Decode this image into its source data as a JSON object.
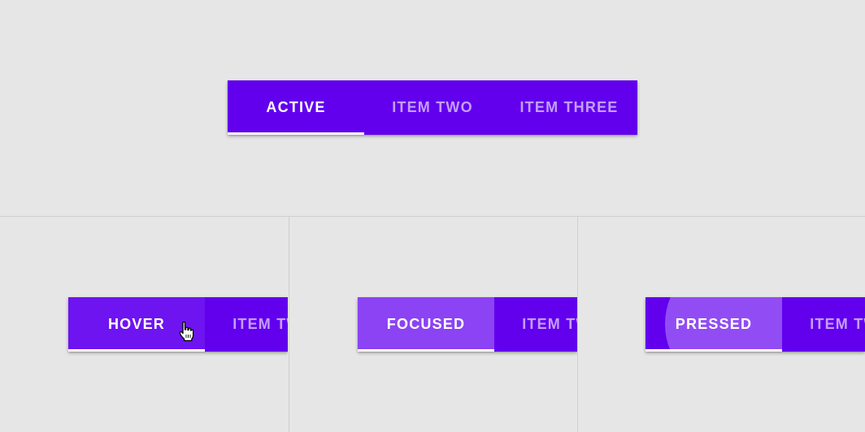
{
  "colors": {
    "background": "#e6e6e6",
    "tab_bar": "#6200ee",
    "active_indicator": "#ffffff",
    "inactive_text": "rgba(255,255,255,0.62)",
    "divider": "#cfcfcf"
  },
  "main_tabs": [
    "ACTIVE",
    "ITEM TWO",
    "ITEM THREE"
  ],
  "hover_panel": {
    "active_label": "HOVER",
    "next_label": "ITEM TWO",
    "cursor_icon": "hand-pointer-icon"
  },
  "focused_panel": {
    "active_label": "FOCUSED",
    "next_label": "ITEM TWO"
  },
  "pressed_panel": {
    "active_label": "PRESSED",
    "next_label": "ITEM TWO"
  }
}
